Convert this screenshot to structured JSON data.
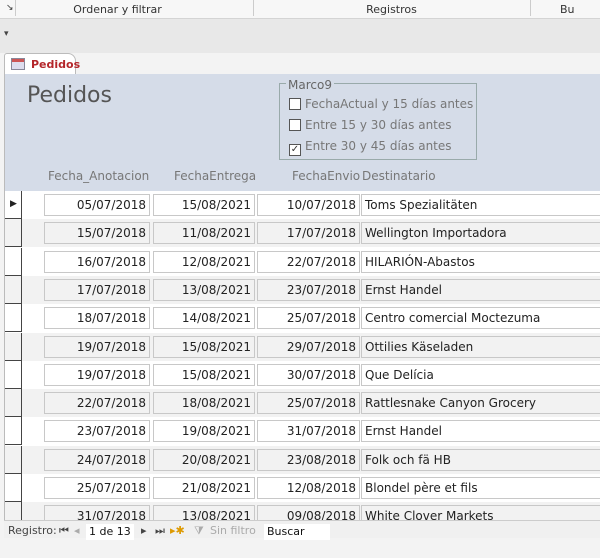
{
  "ribbon": {
    "groups": [
      "Ordenar y filtrar",
      "Registros",
      "Bu"
    ]
  },
  "tab": {
    "label": "Pedidos"
  },
  "form": {
    "title": "Pedidos",
    "frame": {
      "label": "Marco9",
      "options": [
        {
          "label": "FechaActual y 15 días antes",
          "checked": false
        },
        {
          "label": "Entre 15 y 30 días antes",
          "checked": false
        },
        {
          "label": "Entre 30 y 45 días antes",
          "checked": true
        }
      ]
    },
    "columns": [
      "Fecha_Anotacion",
      "FechaEntrega",
      "FechaEnvio",
      "Destinatario"
    ],
    "rows": [
      [
        "05/07/2018",
        "15/08/2021",
        "10/07/2018",
        "Toms Spezialitäten"
      ],
      [
        "15/07/2018",
        "11/08/2021",
        "17/07/2018",
        "Wellington Importadora"
      ],
      [
        "16/07/2018",
        "12/08/2021",
        "22/07/2018",
        "HILARIÓN-Abastos"
      ],
      [
        "17/07/2018",
        "13/08/2021",
        "23/07/2018",
        "Ernst Handel"
      ],
      [
        "18/07/2018",
        "14/08/2021",
        "25/07/2018",
        "Centro comercial Moctezuma"
      ],
      [
        "19/07/2018",
        "15/08/2021",
        "29/07/2018",
        "Ottilies Käseladen"
      ],
      [
        "19/07/2018",
        "15/08/2021",
        "30/07/2018",
        "Que Delícia"
      ],
      [
        "22/07/2018",
        "18/08/2021",
        "25/07/2018",
        "Rattlesnake Canyon Grocery"
      ],
      [
        "23/07/2018",
        "19/08/2021",
        "31/07/2018",
        "Ernst Handel"
      ],
      [
        "24/07/2018",
        "20/08/2021",
        "23/08/2018",
        "Folk och fä HB"
      ],
      [
        "25/07/2018",
        "21/08/2021",
        "12/08/2018",
        "Blondel père et fils"
      ],
      [
        "31/07/2018",
        "13/08/2021",
        "09/08/2018",
        "White Clover Markets"
      ]
    ]
  },
  "nav": {
    "label": "Registro:",
    "position": "1 de 13",
    "filter": "Sin filtro",
    "search": "Buscar"
  }
}
